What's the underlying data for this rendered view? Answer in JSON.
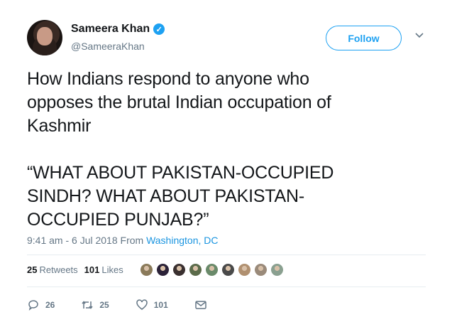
{
  "author": {
    "display_name": "Sameera Khan",
    "handle": "@SameeraKhan",
    "verified_icon": "verified-badge-icon"
  },
  "follow_button": {
    "label": "Follow"
  },
  "tweet": {
    "text": "How Indians respond to anyone who\nopposes the brutal Indian occupation of\nKashmir\n\n“WHAT ABOUT PAKISTAN-OCCUPIED\nSINDH? WHAT ABOUT PAKISTAN-\nOCCUPIED PUNJAB?”",
    "time": "9:41 am - 6 Jul 2018 From ",
    "location": "Washington, DC"
  },
  "stats": {
    "retweets_count": "25",
    "retweets_label": "Retweets",
    "likes_count": "101",
    "likes_label": "Likes",
    "liker_colors": [
      "#8a7a5a",
      "#2b2238",
      "#3a3030",
      "#5b6b4a",
      "#6a8a6a",
      "#4a4a4a",
      "#b09070",
      "#9a8a7a",
      "#8aa090"
    ]
  },
  "actions": {
    "replies": "26",
    "retweets": "25",
    "likes": "101"
  },
  "colors": {
    "accent": "#1da1f2",
    "link": "#1b95e0",
    "muted": "#657786"
  }
}
